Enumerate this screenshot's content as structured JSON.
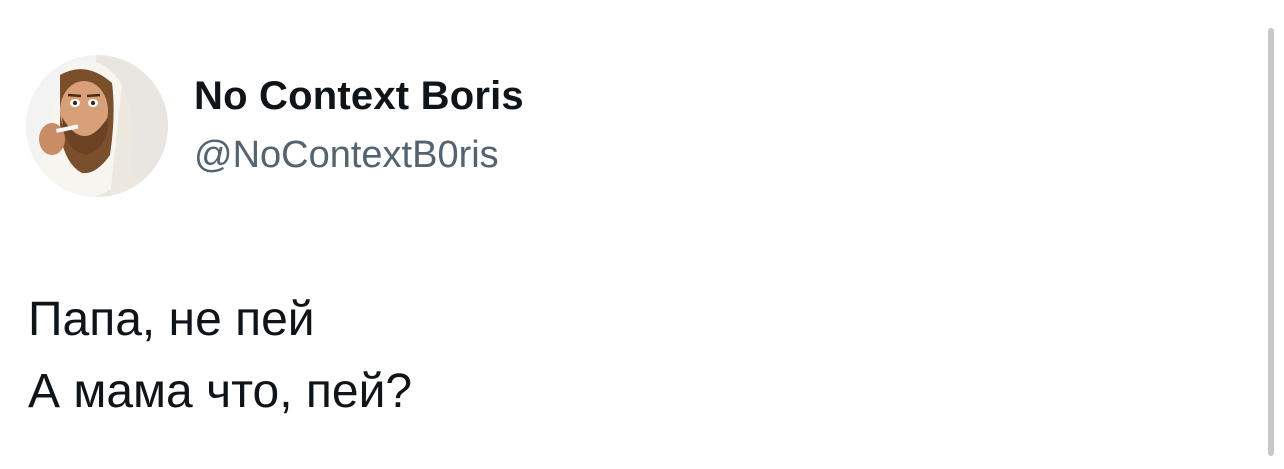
{
  "tweet": {
    "display_name": "No Context Boris",
    "handle": "@NoContextB0ris",
    "text_lines": [
      "Папа, не пей",
      "А мама что, пей?"
    ],
    "avatar_icon": "profile-photo"
  },
  "colors": {
    "name": "#0f1419",
    "handle": "#536471",
    "body": "#0f1419",
    "background": "#ffffff"
  }
}
